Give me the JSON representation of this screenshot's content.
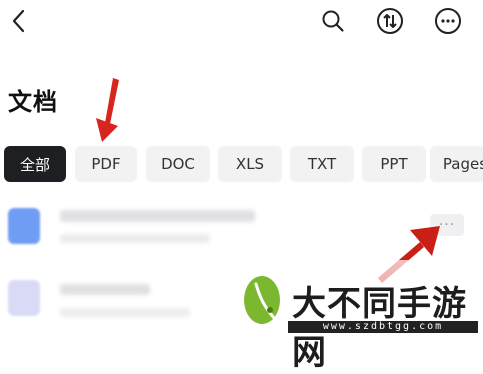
{
  "header": {
    "back_icon": "chevron-left-icon",
    "search_icon": "search-icon",
    "sort_icon": "sort-arrows-icon",
    "more_icon": "more-horizontal-icon"
  },
  "page": {
    "title": "文档"
  },
  "filters": [
    {
      "label": "全部",
      "active": true
    },
    {
      "label": "PDF",
      "active": false
    },
    {
      "label": "DOC",
      "active": false
    },
    {
      "label": "XLS",
      "active": false
    },
    {
      "label": "TXT",
      "active": false
    },
    {
      "label": "PPT",
      "active": false
    },
    {
      "label": "Pages",
      "active": false
    }
  ],
  "files": [
    {
      "icon": "doc-file-icon",
      "more_label": "···"
    },
    {
      "icon": "file-icon"
    }
  ],
  "annotations": {
    "arrow_color": "#d7261e"
  },
  "watermark": {
    "text": "大不同手游网",
    "url": "www.szdbtgg.com"
  },
  "colors": {
    "active_chip": "#1e1f22",
    "chip": "#f2f2f3",
    "accent_blue": "#3f7df0"
  }
}
